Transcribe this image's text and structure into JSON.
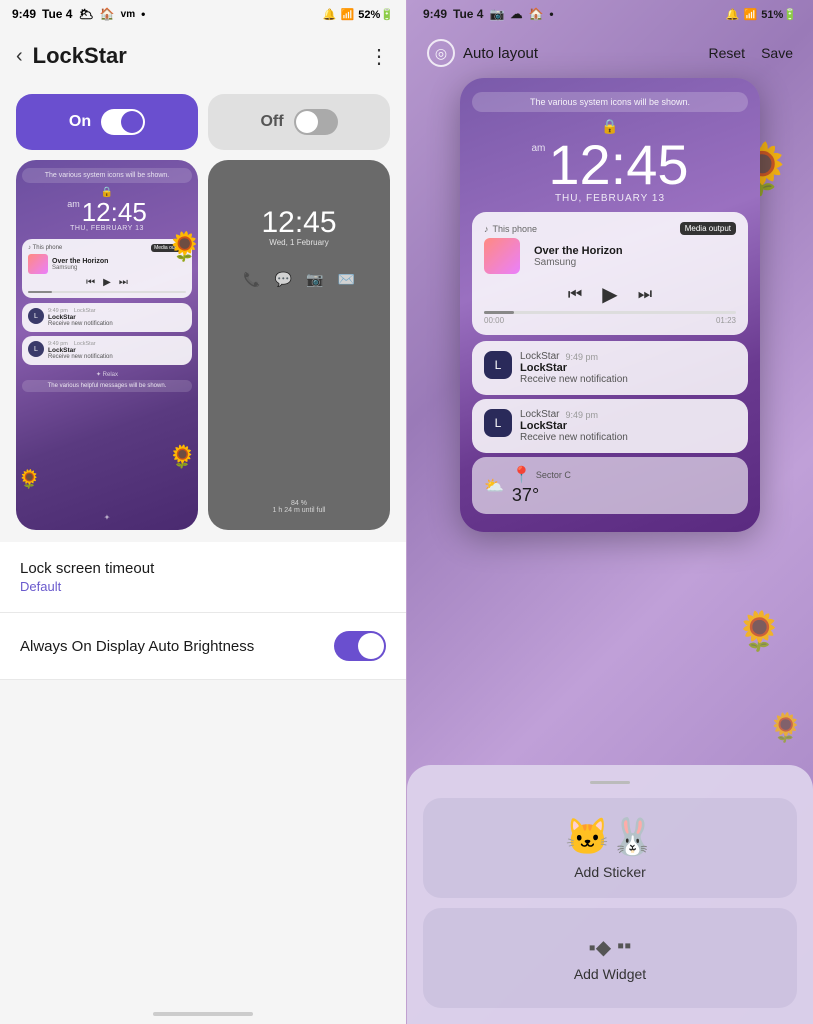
{
  "left": {
    "status": {
      "time": "9:49",
      "day": "Tue 4",
      "icons_right": "📶 52%"
    },
    "header": {
      "title": "LockStar",
      "menu": "⋮"
    },
    "toggle": {
      "on_label": "On",
      "off_label": "Off"
    },
    "preview_on": {
      "sys_notice": "The various system icons will be shown.",
      "am": "am",
      "time": "12:45",
      "date": "THU, FEBRUARY 13",
      "media_phone": "This phone",
      "media_output": "Media output",
      "media_title": "Over the Horizon",
      "media_artist": "Samsung",
      "notif1_app": "LockStar",
      "notif1_time": "9:49 pm",
      "notif1_title": "LockStar",
      "notif1_text": "Receive new notification",
      "notif2_app": "LockStar",
      "notif2_time": "9:49 pm",
      "notif2_title": "LockStar",
      "notif2_text": "Receive new notification",
      "relax": "✦ Relax",
      "helpful": "The various helpful messages will be shown."
    },
    "preview_off": {
      "time": "12:45",
      "date": "Wed, 1 February",
      "battery_pct": "84 %",
      "battery_time": "1 h 24 m until full"
    },
    "settings": {
      "timeout_title": "Lock screen timeout",
      "timeout_sub": "Default",
      "aod_title": "Always On Display Auto Brightness"
    }
  },
  "right": {
    "status": {
      "time": "9:49",
      "day": "Tue 4"
    },
    "header": {
      "icon": "◎",
      "label": "Auto layout",
      "reset": "Reset",
      "save": "Save"
    },
    "phone": {
      "sys_notice": "The various system icons will be shown.",
      "am": "am",
      "time": "12:45",
      "date": "THU, FEBRUARY 13",
      "media_phone": "This phone",
      "media_output": "Media output",
      "media_title": "Over the Horizon",
      "media_artist": "Samsung",
      "time_start": "00:00",
      "time_end": "01:23",
      "notif1_app": "LockStar",
      "notif1_time": "9:49 pm",
      "notif1_title": "LockStar",
      "notif1_text": "Receive new notification",
      "notif2_app": "LockStar",
      "notif2_time": "9:49 pm",
      "notif2_title": "LockStar",
      "notif2_text": "Receive new notification",
      "weather_loc": "Sector C",
      "weather_temp": "37°",
      "weather_icon": "⛅"
    },
    "sticker": {
      "label": "Add Sticker"
    },
    "widget": {
      "label": "Add Widget"
    }
  }
}
